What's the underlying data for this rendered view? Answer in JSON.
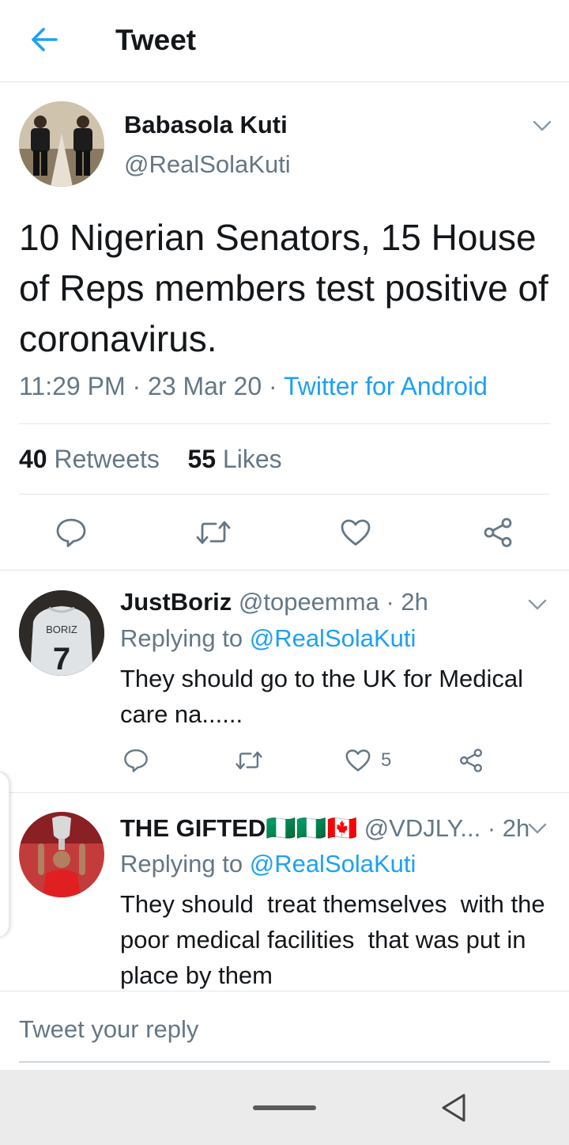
{
  "header": {
    "title": "Tweet"
  },
  "main_tweet": {
    "name": "Babasola Kuti",
    "handle": "@RealSolaKuti",
    "text": "10 Nigerian Senators, 15 House of Reps members test positive of coronavirus.",
    "time": "11:29 PM",
    "date": "23 Mar 20",
    "separator": " · ",
    "source": "Twitter for Android",
    "retweets_count": "40",
    "retweets_label": "Retweets",
    "likes_count": "55",
    "likes_label": "Likes"
  },
  "replies": [
    {
      "name": "JustBoriz",
      "handle": "@topeemma",
      "age": "· 2h",
      "replying_prefix": "Replying to",
      "replying_to": "@RealSolaKuti",
      "text": "They should go to the UK for Medical care na......",
      "like_count": "5",
      "jersey_name": "BORIZ",
      "jersey_number": "7"
    },
    {
      "name": "THE GIFTED",
      "flags": "🇳🇬🇳🇬🇨🇦",
      "handle": "@VDJLY...",
      "age": "· 2h",
      "replying_prefix": "Replying to",
      "replying_to": "@RealSolaKuti",
      "text": "They should  treat themselves  with the poor medical facilities  that was put in place by them"
    }
  ],
  "compose": {
    "placeholder": "Tweet your reply"
  },
  "colors": {
    "accent": "#1da1f2",
    "secondary_text": "#657786",
    "divider": "#e1e8ed",
    "nav_bar": "#ebebeb"
  }
}
